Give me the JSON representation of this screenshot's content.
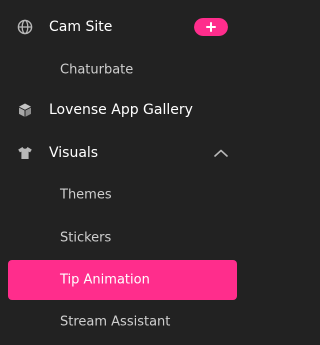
{
  "colors": {
    "background": "#222222",
    "accent": "#ff2d8c",
    "text": "#ffffff",
    "subtext": "#cfcfcf",
    "icon": "#b8b8b8"
  },
  "menu": {
    "cam_site": {
      "label": "Cam Site",
      "icon": "globe-icon",
      "action_icon": "plus-icon",
      "sub_items": [
        {
          "label": "Chaturbate"
        }
      ]
    },
    "app_gallery": {
      "label": "Lovense App Gallery",
      "icon": "cube-icon"
    },
    "visuals": {
      "label": "Visuals",
      "icon": "tshirt-icon",
      "expanded": true,
      "toggle_icon": "chevron-up-icon",
      "sub_items": [
        {
          "label": "Themes"
        },
        {
          "label": "Stickers"
        },
        {
          "label": "Tip Animation",
          "active": true
        },
        {
          "label": "Stream Assistant"
        }
      ]
    }
  }
}
